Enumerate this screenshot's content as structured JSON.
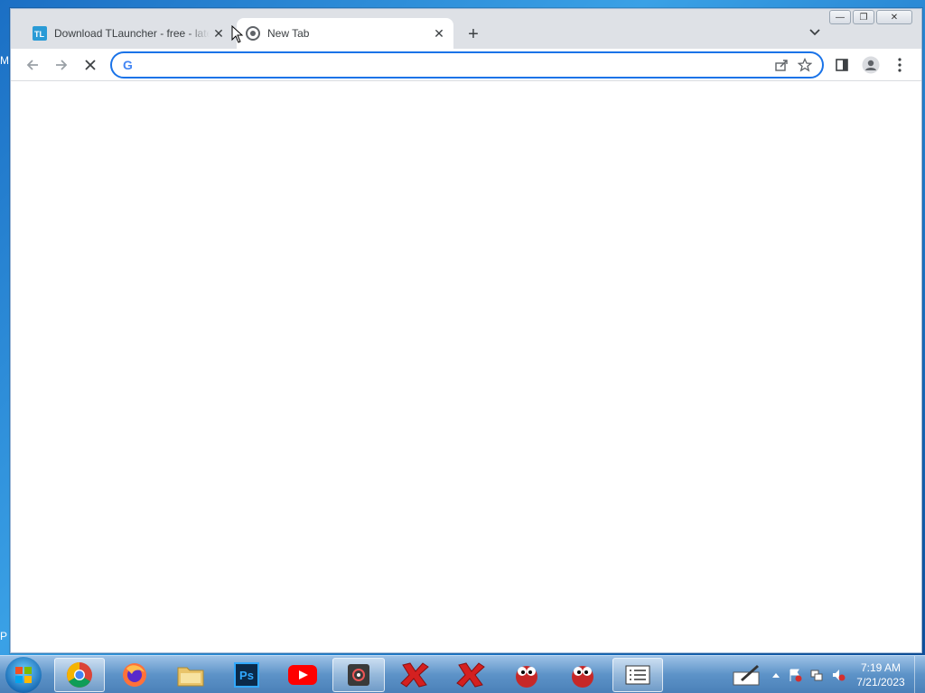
{
  "desktop": {
    "peek_top": "M",
    "peek_bottom": "P"
  },
  "tabs": [
    {
      "title": "Download TLauncher - free - late",
      "favicon": "tlauncher-icon",
      "active": false
    },
    {
      "title": "New Tab",
      "favicon": "chrome-icon",
      "active": true
    }
  ],
  "tabstrip": {
    "new_tab_label": "+",
    "tab_search_icon": "chevron-down-icon"
  },
  "window_controls": {
    "minimize": "—",
    "restore": "❐",
    "close": "✕"
  },
  "toolbar": {
    "back_icon": "arrow-left-icon",
    "forward_icon": "arrow-right-icon",
    "stop_icon": "close-icon",
    "omnibox_value": "",
    "omnibox_placeholder": "",
    "share_icon": "share-icon",
    "bookmark_icon": "star-icon",
    "side_panel_icon": "side-panel-icon",
    "profile_icon": "profile-icon",
    "menu_icon": "kebab-menu-icon"
  },
  "taskbar": {
    "items": [
      {
        "name": "chrome",
        "active": true
      },
      {
        "name": "firefox",
        "active": false
      },
      {
        "name": "file-explorer",
        "active": false
      },
      {
        "name": "photoshop",
        "label": "Ps",
        "active": false
      },
      {
        "name": "youtube",
        "active": false
      },
      {
        "name": "unknown-app",
        "active": true
      },
      {
        "name": "red-x-app-1",
        "active": false
      },
      {
        "name": "red-x-app-2",
        "active": false
      },
      {
        "name": "red-ball-app-1",
        "active": false
      },
      {
        "name": "red-ball-app-2",
        "active": false
      },
      {
        "name": "list-app",
        "active": true
      }
    ],
    "clock_time": "7:19 AM",
    "clock_date": "7/21/2023"
  }
}
